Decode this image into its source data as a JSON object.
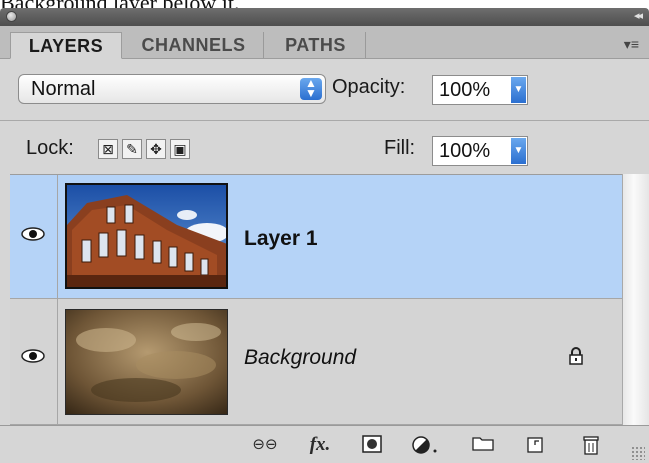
{
  "caption": "Background layer below it.",
  "panel": {
    "tabs": [
      {
        "label": "LAYERS",
        "active": true
      },
      {
        "label": "CHANNELS",
        "active": false
      },
      {
        "label": "PATHS",
        "active": false
      }
    ],
    "blend_mode": "Normal",
    "opacity_label": "Opacity:",
    "opacity_value": "100%",
    "lock_label": "Lock:",
    "lock_icons": [
      "lock-transparent-pixels-icon",
      "lock-image-pixels-icon",
      "lock-position-icon",
      "lock-all-icon"
    ],
    "fill_label": "Fill:",
    "fill_value": "100%",
    "layers": [
      {
        "name": "Layer 1",
        "selected": true,
        "visible": true,
        "locked": false
      },
      {
        "name": "Background",
        "selected": false,
        "visible": true,
        "locked": true
      }
    ],
    "footer_icons": [
      "link-layers-icon",
      "layer-style-fx-icon",
      "layer-mask-icon",
      "adjustment-layer-icon",
      "new-group-folder-icon",
      "new-layer-icon",
      "trash-icon"
    ],
    "colors": {
      "selection": "#b5d3f7",
      "panel_bg": "#d6d6d6",
      "accent_blue": "#2b6fd0"
    }
  }
}
